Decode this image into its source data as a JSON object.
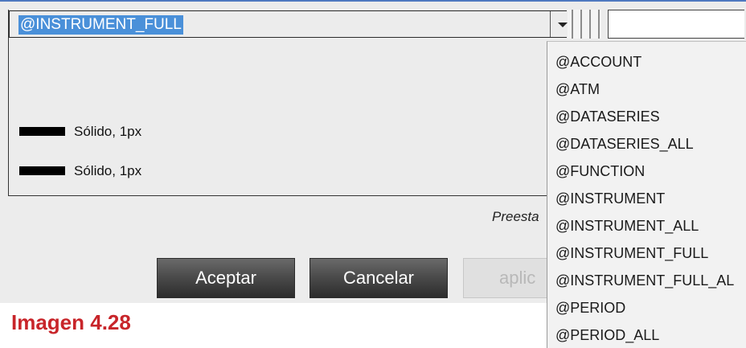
{
  "combo": {
    "selected_value": "@INSTRUMENT_FULL"
  },
  "line_styles": [
    {
      "label": "Sólido, 1px"
    },
    {
      "label": "Sólido, 1px"
    }
  ],
  "presets_label": "Preesta",
  "buttons": {
    "accept": "Aceptar",
    "cancel": "Cancelar",
    "apply": "aplic"
  },
  "caption": "Imagen 4.28",
  "dropdown": {
    "items": [
      "@ACCOUNT",
      "@ATM",
      "@DATASERIES",
      "@DATASERIES_ALL",
      "@FUNCTION",
      "@INSTRUMENT",
      "@INSTRUMENT_ALL",
      "@INSTRUMENT_FULL",
      "@INSTRUMENT_FULL_AL",
      "@PERIOD",
      "@PERIOD_ALL"
    ]
  },
  "colors": {
    "selection": "#4a90d9",
    "caption": "#c8252a",
    "button_dark": "#3f3f3f"
  }
}
